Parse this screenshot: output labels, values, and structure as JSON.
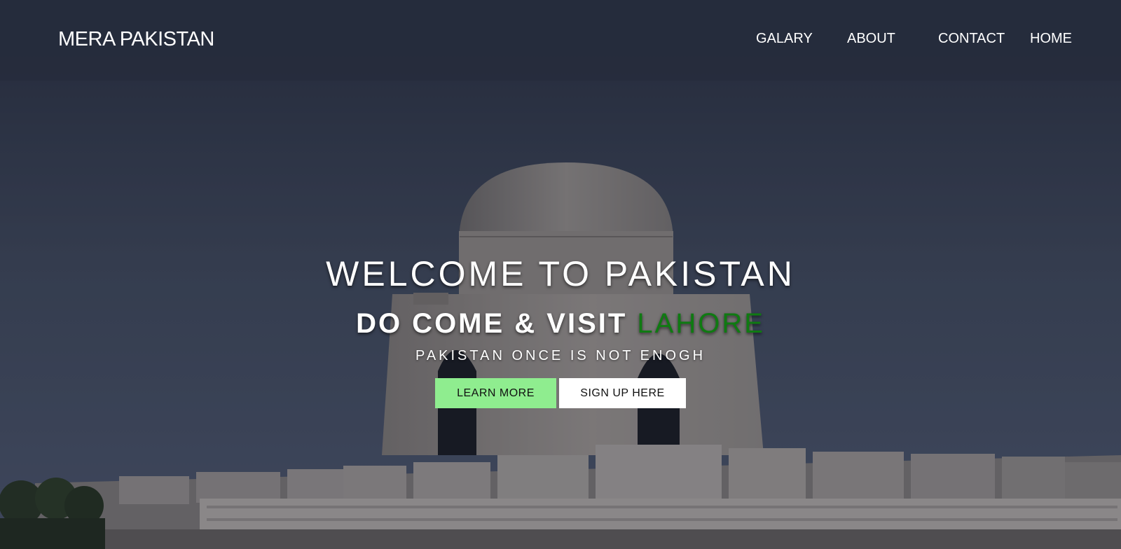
{
  "header": {
    "brand": "MERA PAKISTAN",
    "nav": [
      {
        "label": "GALARY"
      },
      {
        "label": "ABOUT"
      },
      {
        "label": "CONTACT"
      },
      {
        "label": "HOME"
      }
    ]
  },
  "hero": {
    "title": "WELCOME TO PAKISTAN",
    "subtitle_prefix": "DO COME & VISIT ",
    "subtitle_highlight": "LAHORE",
    "tagline": "PAKISTAN ONCE IS NOT ENOGH",
    "learn_more_label": "LEARN MORE",
    "signup_label": "SIGN UP HERE"
  },
  "colors": {
    "accent_green": "#0f7a12",
    "learn_button_bg": "#8fed8f"
  }
}
